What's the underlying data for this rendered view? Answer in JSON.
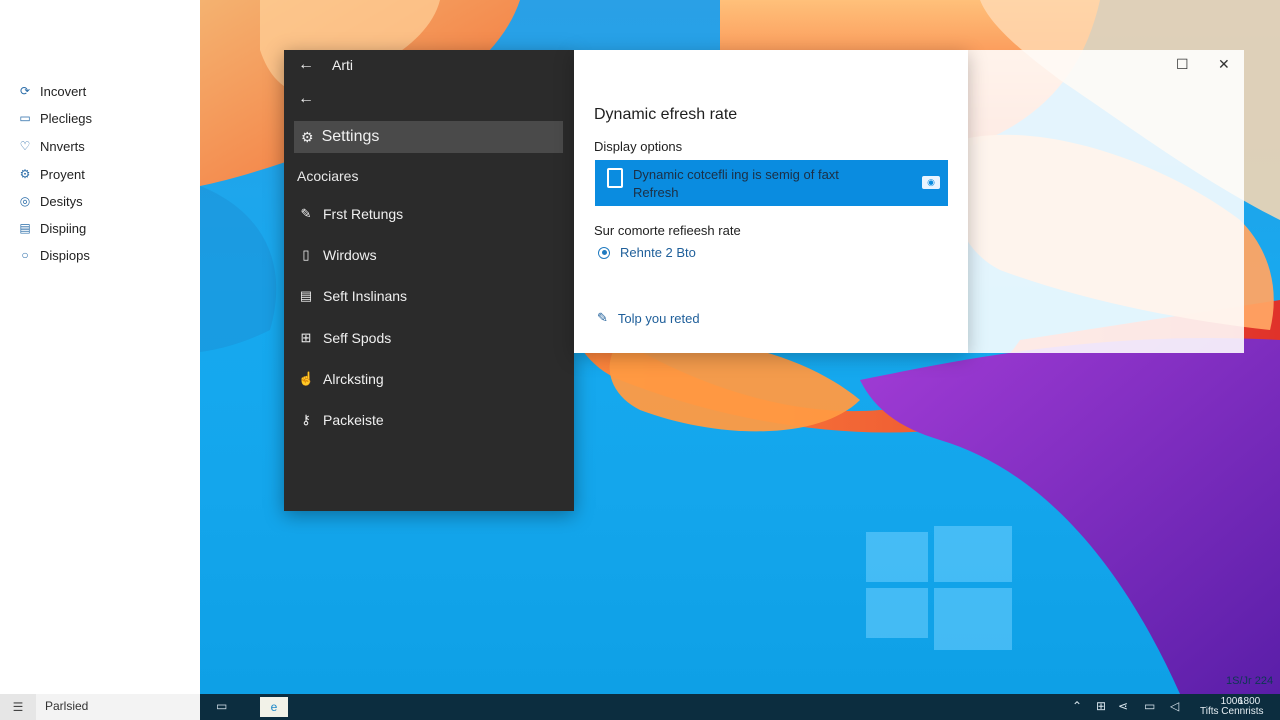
{
  "left_panel": {
    "items": [
      {
        "label": "Incovert",
        "icon": "sync-icon"
      },
      {
        "label": "Plecliegs",
        "icon": "monitor-icon"
      },
      {
        "label": "Nnverts",
        "icon": "pin-icon"
      },
      {
        "label": "Proyent",
        "icon": "gear-icon"
      },
      {
        "label": "Desitys",
        "icon": "globe-icon"
      },
      {
        "label": "Dispiing",
        "icon": "display-icon"
      },
      {
        "label": "Dispiops",
        "icon": "circle-icon"
      }
    ],
    "bottom_label": "Parlsied"
  },
  "dark_window": {
    "title": "Arti",
    "selected_label": "Settings",
    "section_label": "Acociares",
    "items": [
      {
        "label": "Frst Retungs",
        "icon": "pen-icon"
      },
      {
        "label": "Wirdows",
        "icon": "window-icon"
      },
      {
        "label": "Seft Inslinans",
        "icon": "list-icon"
      },
      {
        "label": "Seff Spods",
        "icon": "speaker-icon"
      },
      {
        "label": "Alrcksting",
        "icon": "hand-icon"
      },
      {
        "label": "Packeiste",
        "icon": "key-icon"
      }
    ]
  },
  "dialog": {
    "title": "Dynamic efresh rate",
    "subtitle": "Display options",
    "selected_option": {
      "line1": "Dynamic cotcefli ing is semig of faxt",
      "line2": "Refresh",
      "icon": "phone-icon"
    },
    "label2": "Sur comorte refieesh rate",
    "radio_label": "Rehnte 2 Bto",
    "help_link": "Tolp you reted",
    "accent_color": "#0a8ce0"
  },
  "taskbar": {
    "time": "1800",
    "date": "Tifts Cennrists",
    "time2": "1006"
  },
  "desktop_date": "1S/Jr 224"
}
